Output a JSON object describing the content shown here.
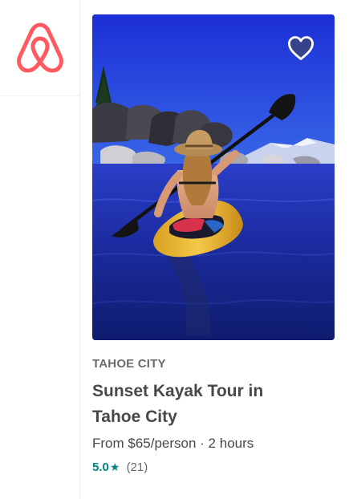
{
  "colors": {
    "brand": "#FF5A5F",
    "rating": "#008489",
    "text_primary": "#484848",
    "text_secondary": "#6b6b6b"
  },
  "sidebar": {
    "logo_icon": "airbnb-belo-icon"
  },
  "card": {
    "favorite_icon": "heart-outline-icon",
    "location": "TAHOE CITY",
    "title": "Sunset Kayak Tour in Tahoe City",
    "price_line": "From $65/person · 2 hours",
    "rating": {
      "value": "5.0",
      "star": "★",
      "count": "(21)"
    }
  }
}
